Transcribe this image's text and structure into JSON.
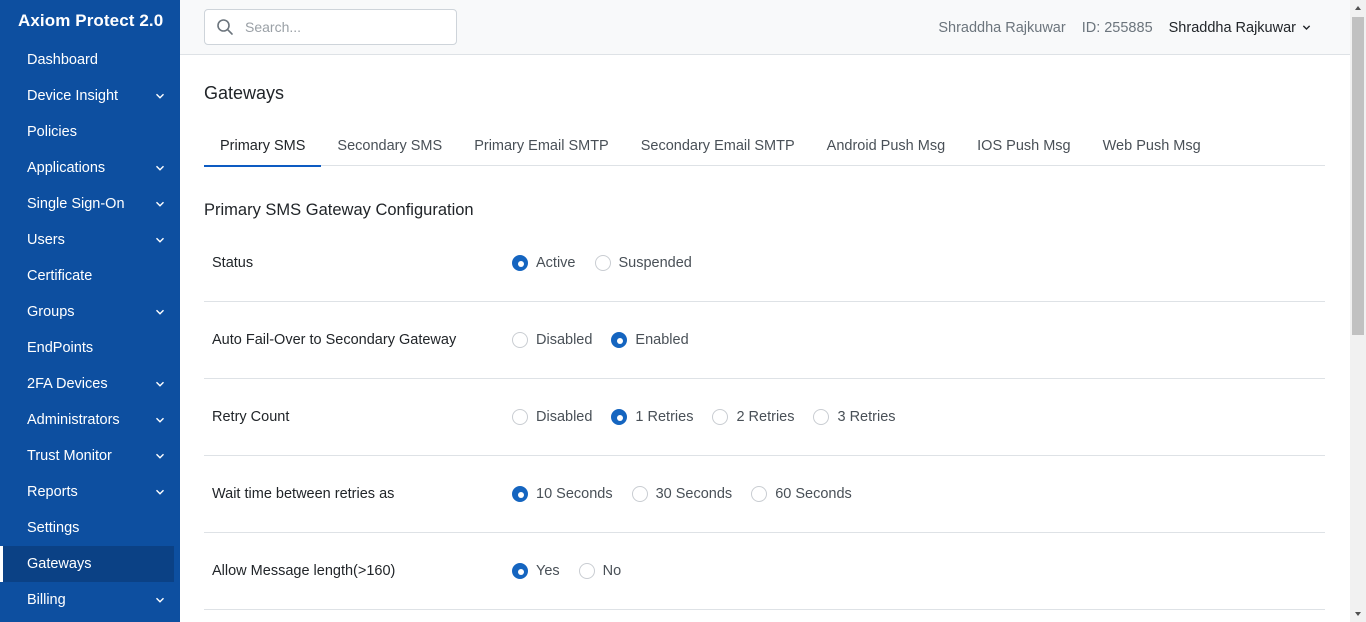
{
  "app": {
    "title": "Axiom Protect 2.0"
  },
  "sidebar": {
    "items": [
      {
        "label": "Dashboard",
        "has_children": false
      },
      {
        "label": "Device Insight",
        "has_children": true
      },
      {
        "label": "Policies",
        "has_children": false
      },
      {
        "label": "Applications",
        "has_children": true
      },
      {
        "label": "Single Sign-On",
        "has_children": true
      },
      {
        "label": "Users",
        "has_children": true
      },
      {
        "label": "Certificate",
        "has_children": false
      },
      {
        "label": "Groups",
        "has_children": true
      },
      {
        "label": "EndPoints",
        "has_children": false
      },
      {
        "label": "2FA Devices",
        "has_children": true
      },
      {
        "label": "Administrators",
        "has_children": true
      },
      {
        "label": "Trust Monitor",
        "has_children": true
      },
      {
        "label": "Reports",
        "has_children": true
      },
      {
        "label": "Settings",
        "has_children": false
      },
      {
        "label": "Gateways",
        "has_children": false,
        "active": true
      },
      {
        "label": "Billing",
        "has_children": true
      }
    ]
  },
  "header": {
    "search_placeholder": "Search...",
    "user_name": "Shraddha Rajkuwar",
    "user_id": "ID: 255885",
    "user_menu_label": "Shraddha Rajkuwar"
  },
  "main": {
    "title": "Gateways",
    "tabs": [
      {
        "label": "Primary SMS",
        "active": true
      },
      {
        "label": "Secondary SMS"
      },
      {
        "label": "Primary Email SMTP"
      },
      {
        "label": "Secondary Email SMTP"
      },
      {
        "label": "Android Push Msg"
      },
      {
        "label": "IOS Push Msg"
      },
      {
        "label": "Web Push Msg"
      }
    ],
    "section_title": "Primary SMS Gateway Configuration",
    "fields": [
      {
        "label": "Status",
        "options": [
          "Active",
          "Suspended"
        ],
        "selected": "Active"
      },
      {
        "label": "Auto Fail-Over to Secondary Gateway",
        "options": [
          "Disabled",
          "Enabled"
        ],
        "selected": "Enabled"
      },
      {
        "label": "Retry Count",
        "options": [
          "Disabled",
          "1 Retries",
          "2 Retries",
          "3 Retries"
        ],
        "selected": "1 Retries"
      },
      {
        "label": "Wait time between retries as",
        "options": [
          "10 Seconds",
          "30 Seconds",
          "60 Seconds"
        ],
        "selected": "10 Seconds"
      },
      {
        "label": "Allow Message length(>160)",
        "options": [
          "Yes",
          "No"
        ],
        "selected": "Yes"
      }
    ]
  },
  "colors": {
    "sidebar_bg": "#0d4fa0",
    "accent": "#1565c0"
  }
}
